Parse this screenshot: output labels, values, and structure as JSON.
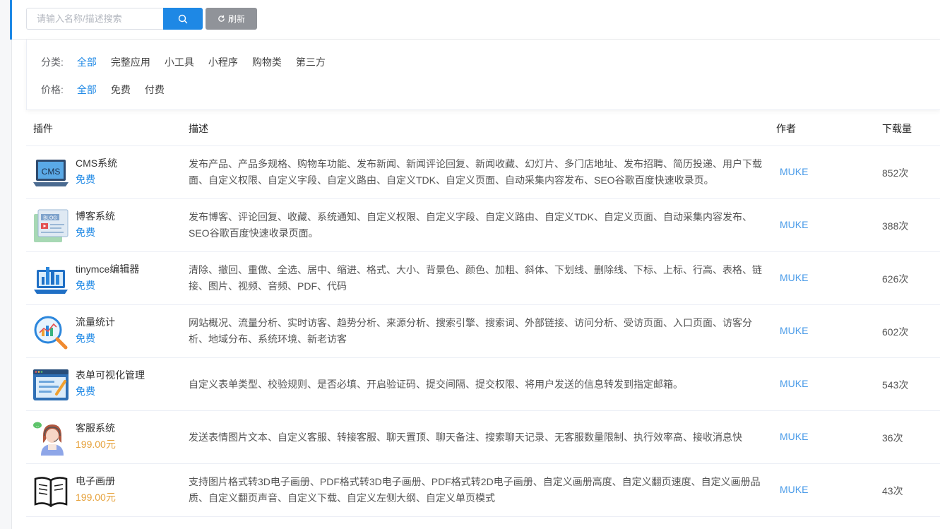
{
  "search": {
    "placeholder": "请输入名称/描述搜索",
    "refresh_label": "刷新"
  },
  "filters": {
    "category": {
      "label": "分类:",
      "options": [
        "全部",
        "完整应用",
        "小工具",
        "小程序",
        "购物类",
        "第三方"
      ],
      "active": 0
    },
    "price": {
      "label": "价格:",
      "options": [
        "全部",
        "免费",
        "付费"
      ],
      "active": 0
    }
  },
  "table": {
    "headers": {
      "plugin": "插件",
      "desc": "描述",
      "author": "作者",
      "downloads": "下载量"
    },
    "rows": [
      {
        "name": "CMS系统",
        "price": "免费",
        "price_type": "free",
        "icon": "cms-laptop-icon",
        "desc": "发布产品、产品多规格、购物车功能、发布新闻、新闻评论回复、新闻收藏、幻灯片、多门店地址、发布招聘、简历投递、用户下载面、自定义权限、自定义字段、自定义路由、自定义TDK、自定义页面、自动采集内容发布、SEO谷歌百度快速收录页。",
        "author": "MUKE",
        "downloads": "852次"
      },
      {
        "name": "博客系统",
        "price": "免费",
        "price_type": "free",
        "icon": "blog-icon",
        "desc": "发布博客、评论回复、收藏、系统通知、自定义权限、自定义字段、自定义路由、自定义TDK、自定义页面、自动采集内容发布、SEO谷歌百度快速收录页面。",
        "author": "MUKE",
        "downloads": "388次"
      },
      {
        "name": "tinymce编辑器",
        "price": "免费",
        "price_type": "free",
        "icon": "editor-laptop-icon",
        "desc": "清除、撤回、重做、全选、居中、缩进、格式、大小、背景色、颜色、加粗、斜体、下划线、删除线、下标、上标、行高、表格、链接、图片、视频、音频、PDF、代码",
        "author": "MUKE",
        "downloads": "626次"
      },
      {
        "name": "流量统计",
        "price": "免费",
        "price_type": "free",
        "icon": "analytics-magnifier-icon",
        "desc": "网站概况、流量分析、实时访客、趋势分析、来源分析、搜索引擎、搜索词、外部链接、访问分析、受访页面、入口页面、访客分析、地域分布、系统环境、新老访客",
        "author": "MUKE",
        "downloads": "602次"
      },
      {
        "name": "表单可视化管理",
        "price": "免费",
        "price_type": "free",
        "icon": "form-editor-icon",
        "desc": "自定义表单类型、校验规则、是否必填、开启验证码、提交间隔、提交权限、将用户发送的信息转发到指定邮箱。",
        "author": "MUKE",
        "downloads": "543次"
      },
      {
        "name": "客服系统",
        "price": "199.00元",
        "price_type": "paid",
        "icon": "customer-service-icon",
        "desc": "发送表情图片文本、自定义客服、转接客服、聊天置顶、聊天备注、搜索聊天记录、无客服数量限制、执行效率高、接收消息快",
        "author": "MUKE",
        "downloads": "36次"
      },
      {
        "name": "电子画册",
        "price": "199.00元",
        "price_type": "paid",
        "icon": "open-book-icon",
        "desc": "支持图片格式转3D电子画册、PDF格式转3D电子画册、PDF格式转2D电子画册、自定义画册高度、自定义翻页速度、自定义画册品质、自定义翻页声音、自定义下载、自定义左侧大纲、自定义单页模式",
        "author": "MUKE",
        "downloads": "43次"
      }
    ]
  }
}
